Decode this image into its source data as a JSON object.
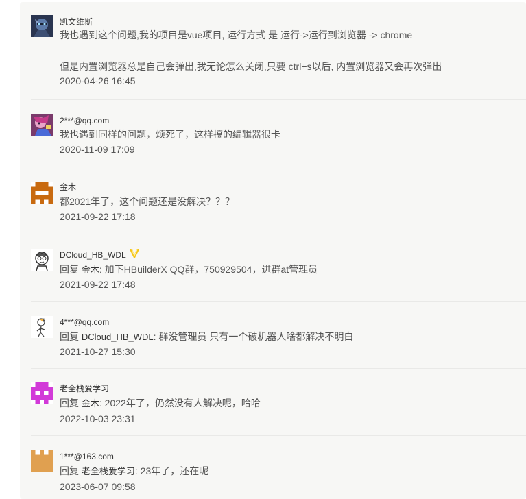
{
  "comments": [
    {
      "username": "凯文维斯",
      "avatar_icon": "dark-robot-avatar-icon",
      "lines": [
        "我也遇到这个问题,我的项目是vue项目, 运行方式 是 运行->运行到浏览器 -> chrome",
        "但是内置浏览器总是自己会弹出,我无论怎么关闭,只要 ctrl+s以后, 内置浏览器又会再次弹出"
      ],
      "time": "2020-04-26 16:45"
    },
    {
      "username": "2***@qq.com",
      "avatar_icon": "anime-character-avatar-icon",
      "lines": [
        "我也遇到同样的问题，烦死了，这样搞的编辑器很卡"
      ],
      "time": "2020-11-09 17:09"
    },
    {
      "username": "金木",
      "avatar_icon": "orange-pixel-avatar-icon",
      "lines": [
        "都2021年了，这个问题还是没解决？？？"
      ],
      "time": "2021-09-22 17:18"
    },
    {
      "username": "DCloud_HB_WDL",
      "avatar_icon": "cartoon-face-avatar-icon",
      "badge_icon": "v-badge-icon",
      "reply_prefix": "回复",
      "reply_to": "金木",
      "text": ": 加下HBuilderX QQ群，750929504，进群at管理员",
      "time": "2021-09-22 17:48"
    },
    {
      "username": "4***@qq.com",
      "avatar_icon": "sketch-figure-avatar-icon",
      "reply_prefix": "回复",
      "reply_to": "DCloud_HB_WDL",
      "text": ": 群没管理员 只有一个破机器人啥都解决不明白",
      "time": "2021-10-27 15:30"
    },
    {
      "username": "老全栈爱学习",
      "avatar_icon": "magenta-pixel-avatar-icon",
      "reply_prefix": "回复",
      "reply_to": "金木",
      "text": ": 2022年了，仍然没有人解决呢，哈哈",
      "time": "2022-10-03 23:31"
    },
    {
      "username": "1***@163.com",
      "avatar_icon": "tan-pixel-avatar-icon",
      "reply_prefix": "回复",
      "reply_to": "老全栈爱学习",
      "text": ": 23年了，还在呢",
      "time": "2023-06-07 09:58"
    }
  ],
  "colors": {
    "panel_bg": "#f7f7f5",
    "text": "#555555",
    "username": "#333333",
    "badge": "#f5c518"
  }
}
